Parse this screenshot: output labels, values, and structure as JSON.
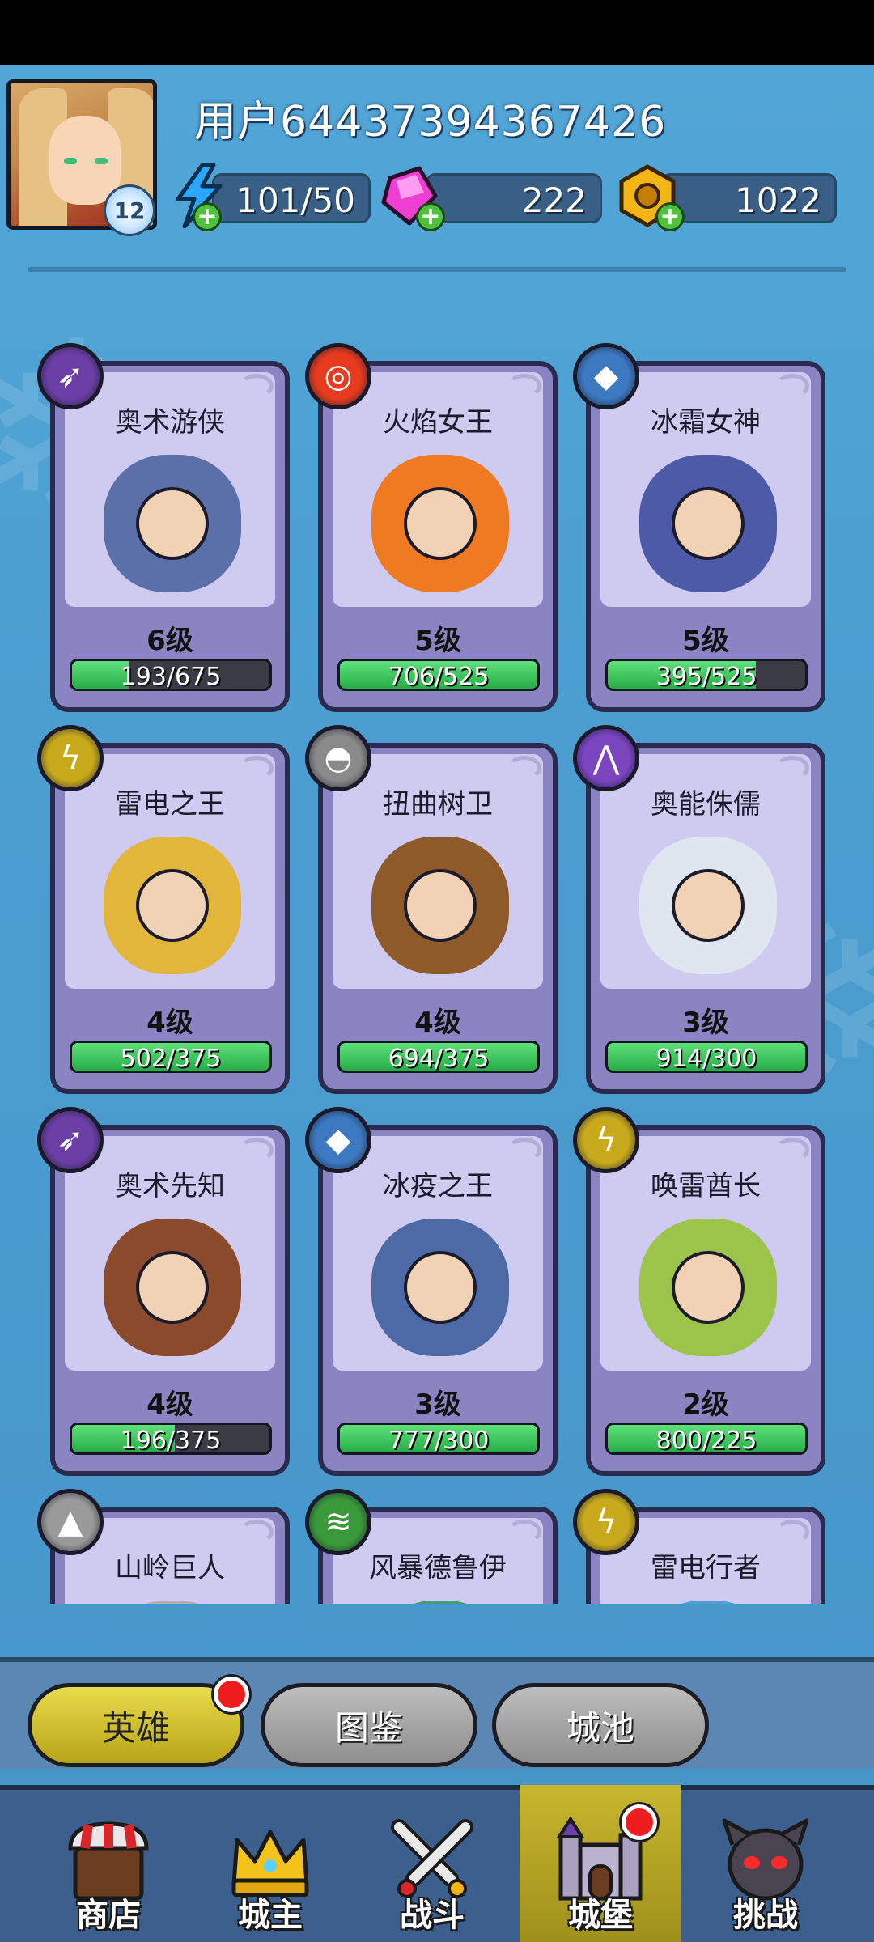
{
  "header": {
    "username": "用户64437394367426",
    "avatar_level": "12",
    "resources": [
      {
        "name": "energy",
        "icon": "lightning-icon",
        "value": "101/50"
      },
      {
        "name": "gems",
        "icon": "pink-gem-icon",
        "value": "222"
      },
      {
        "name": "gold",
        "icon": "gold-coin-icon",
        "value": "1022"
      }
    ]
  },
  "heroes": [
    {
      "name": "奥术游侠",
      "level": "6级",
      "progress": "193/675",
      "ratio": 0.29,
      "element_icon": "arcane-arrows-icon",
      "element_color": "#6b3fa6",
      "hero_color": "#5b6fa8"
    },
    {
      "name": "火焰女王",
      "level": "5级",
      "progress": "706/525",
      "ratio": 1.0,
      "element_icon": "fire-ring-icon",
      "element_color": "#e63b1e",
      "hero_color": "#f07a22"
    },
    {
      "name": "冰霜女神",
      "level": "5级",
      "progress": "395/525",
      "ratio": 0.75,
      "element_icon": "ice-crystal-icon",
      "element_color": "#3c79c1",
      "hero_color": "#4c5aa8"
    },
    {
      "name": "雷电之王",
      "level": "4级",
      "progress": "502/375",
      "ratio": 1.0,
      "element_icon": "lightning-bolt-icon",
      "element_color": "#c8aa1c",
      "hero_color": "#e2b63a"
    },
    {
      "name": "扭曲树卫",
      "level": "4级",
      "progress": "694/375",
      "ratio": 1.0,
      "element_icon": "neutral-orb-icon",
      "element_color": "#8a8a8a",
      "hero_color": "#8e5a2a"
    },
    {
      "name": "奥能侏儒",
      "level": "3级",
      "progress": "914/300",
      "ratio": 1.0,
      "element_icon": "arcane-claw-icon",
      "element_color": "#7b45c0",
      "hero_color": "#dfe6f0"
    },
    {
      "name": "奥术先知",
      "level": "4级",
      "progress": "196/375",
      "ratio": 0.52,
      "element_icon": "arcane-arrows-icon",
      "element_color": "#6b3fa6",
      "hero_color": "#8a4a2c"
    },
    {
      "name": "冰疫之王",
      "level": "3级",
      "progress": "777/300",
      "ratio": 1.0,
      "element_icon": "ice-crystal-icon",
      "element_color": "#3c79c1",
      "hero_color": "#4e6aa6"
    },
    {
      "name": "唤雷酋长",
      "level": "2级",
      "progress": "800/225",
      "ratio": 1.0,
      "element_icon": "lightning-bolt-icon",
      "element_color": "#c8aa1c",
      "hero_color": "#9cc44a"
    },
    {
      "name": "山岭巨人",
      "level": "",
      "progress": "",
      "ratio": 0,
      "element_icon": "rock-spikes-icon",
      "element_color": "#9a9a9a",
      "hero_color": "#b0b0b0"
    },
    {
      "name": "风暴德鲁伊",
      "level": "",
      "progress": "",
      "ratio": 0,
      "element_icon": "wind-swirl-icon",
      "element_color": "#3a9a3a",
      "hero_color": "#3aa07a"
    },
    {
      "name": "雷电行者",
      "level": "",
      "progress": "",
      "ratio": 0,
      "element_icon": "lightning-bolt-icon",
      "element_color": "#c8aa1c",
      "hero_color": "#4aa0d8"
    }
  ],
  "tabs": [
    {
      "label": "英雄",
      "active": true,
      "badge": true
    },
    {
      "label": "图鉴",
      "active": false,
      "badge": false
    },
    {
      "label": "城池",
      "active": false,
      "badge": false
    }
  ],
  "nav": [
    {
      "label": "商店",
      "icon": "shop-awning-icon",
      "active": false,
      "badge": false
    },
    {
      "label": "城主",
      "icon": "crown-icon",
      "active": false,
      "badge": false
    },
    {
      "label": "战斗",
      "icon": "crossed-swords-icon",
      "active": false,
      "badge": false
    },
    {
      "label": "城堡",
      "icon": "castle-icon",
      "active": true,
      "badge": true
    },
    {
      "label": "挑战",
      "icon": "demon-mask-icon",
      "active": false,
      "badge": false
    }
  ]
}
